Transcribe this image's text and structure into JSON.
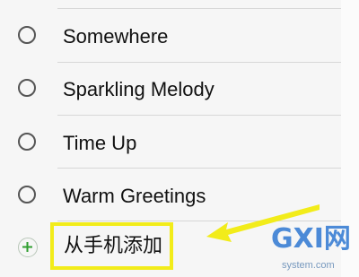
{
  "list": {
    "items": [
      {
        "label": "Somewhere"
      },
      {
        "label": "Sparkling Melody"
      },
      {
        "label": "Time Up"
      },
      {
        "label": "Warm Greetings"
      }
    ],
    "add_label": "从手机添加"
  },
  "annotation": {
    "highlight_color": "#f2ec1a",
    "arrow_color": "#f2ec1a"
  },
  "watermark": {
    "logo": "GXI网",
    "site": "system.com"
  }
}
